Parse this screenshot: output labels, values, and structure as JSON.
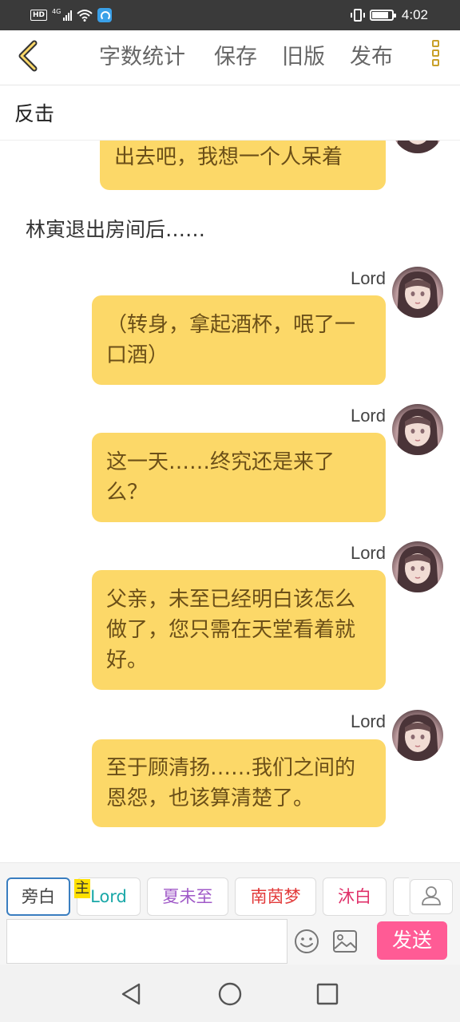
{
  "status_bar": {
    "left_badge": "HD",
    "network": "4G",
    "time": "4:02",
    "battery_level": 0.85
  },
  "toolbar": {
    "back_icon": "chevron-left-icon",
    "word_count_label": "字数统计",
    "save_label": "保存",
    "old_version_label": "旧版",
    "publish_label": "发布",
    "more_icon": "more-vertical-icon",
    "accent_color": "#c8a02a"
  },
  "story_title": "反击",
  "messages": [
    {
      "type": "bubble",
      "sender": "",
      "text": "出去吧，我想一个人呆着"
    },
    {
      "type": "narration",
      "text": "林寅退出房间后……"
    },
    {
      "type": "bubble",
      "sender": "Lord",
      "text": "（转身，拿起酒杯，呡了一口酒）"
    },
    {
      "type": "bubble",
      "sender": "Lord",
      "text": "这一天……终究还是来了么？"
    },
    {
      "type": "bubble",
      "sender": "Lord",
      "text": "父亲，未至已经明白该怎么做了，您只需在天堂看着就好。"
    },
    {
      "type": "bubble",
      "sender": "Lord",
      "text": "至于顾清扬……我们之间的恩怨，也该算清楚了。"
    }
  ],
  "bubble_color": "#fcd868",
  "characters": [
    {
      "name": "旁白",
      "color": "#444444",
      "active": true
    },
    {
      "name": "Lord",
      "color": "#1aa8a8",
      "badge": "主"
    },
    {
      "name": "夏未至",
      "color": "#a05ac8"
    },
    {
      "name": "南茵梦",
      "color": "#e23a3a"
    },
    {
      "name": "沐白",
      "color": "#e0306a"
    }
  ],
  "composer": {
    "placeholder": "",
    "emoji_icon": "smiley-icon",
    "image_icon": "image-icon",
    "person_icon": "person-icon",
    "send_label": "发送",
    "send_color": "#ff5b95"
  },
  "nav_bar": {
    "back_icon": "triangle-back-icon",
    "home_icon": "circle-home-icon",
    "recents_icon": "square-recents-icon"
  }
}
